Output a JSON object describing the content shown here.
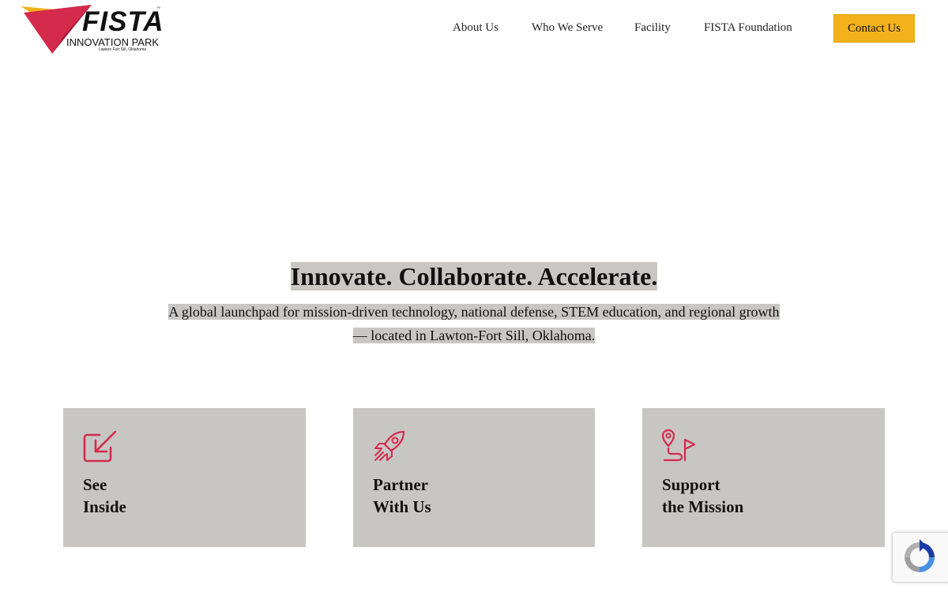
{
  "header": {
    "logo": {
      "title": "FISTA",
      "subtitle": "INNOVATION PARK",
      "location": "Lawton Fort Sill, Oklahoma",
      "trademark": "™"
    },
    "nav": [
      {
        "label": "About Us"
      },
      {
        "label": "Who We Serve"
      },
      {
        "label": "Facility"
      },
      {
        "label": "FISTA Foundation"
      }
    ],
    "contact_label": "Contact Us"
  },
  "hero": {
    "title": "Innovate. Collaborate. Accelerate.",
    "subtitle_line1": "A global launchpad for mission-driven technology, national defense, STEM education, and regional growth",
    "subtitle_line2": "— located in Lawton-Fort Sill, Oklahoma."
  },
  "cards": [
    {
      "line1": "See",
      "line2": "Inside",
      "icon": "arrow-in-box-icon"
    },
    {
      "line1": "Partner",
      "line2": "With Us",
      "icon": "rocket-icon"
    },
    {
      "line1": "Support",
      "line2": "the Mission",
      "icon": "route-pin-flag-icon"
    }
  ],
  "colors": {
    "accent_red": "#d42a4c",
    "button_yellow": "#f3b21a",
    "card_gray": "#c8c6c3",
    "highlight_gray": "#c9c7c4"
  }
}
